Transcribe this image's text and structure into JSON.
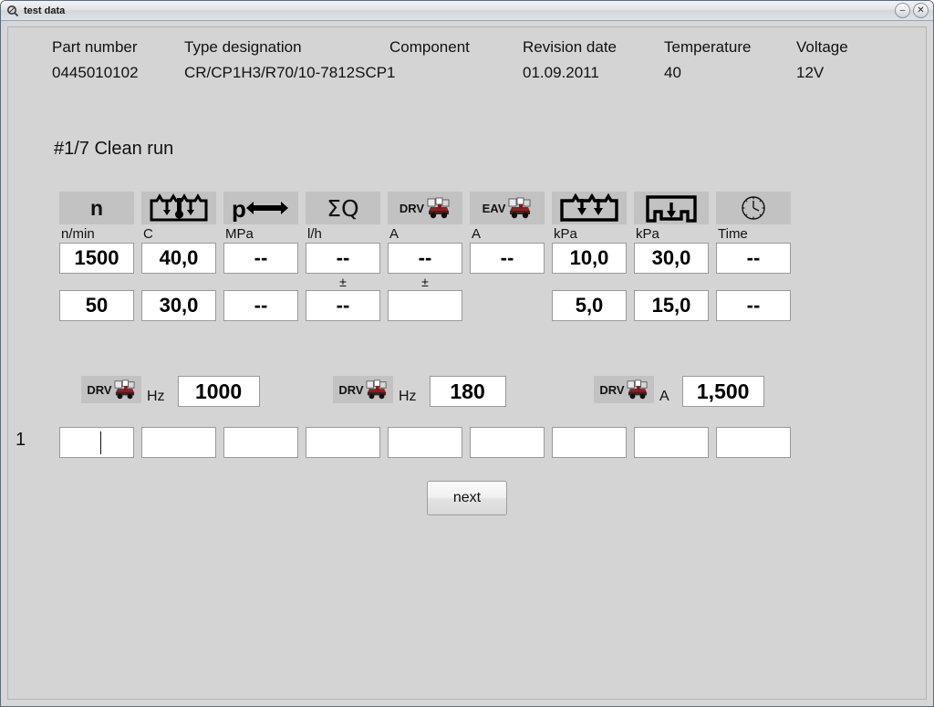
{
  "window": {
    "title": "test data",
    "icon": "app-icon",
    "buttons": [
      {
        "name": "minimize-button",
        "glyph": "–"
      },
      {
        "name": "close-button",
        "glyph": "✕"
      }
    ]
  },
  "meta": [
    {
      "label": "Part number",
      "value": "0445010102"
    },
    {
      "label": "Type designation",
      "value": "CR/CP1H3/R70/10-7812SCP1"
    },
    {
      "label": "Component",
      "value": ""
    },
    {
      "label": "Revision date",
      "value": "01.09.2011"
    },
    {
      "label": "Temperature",
      "value": "40"
    },
    {
      "label": "Voltage",
      "value": "12V"
    }
  ],
  "run_title": "#1/7 Clean run",
  "columns": [
    {
      "icon": "speed-n-icon",
      "icon_text": "n",
      "unit": "n/min"
    },
    {
      "icon": "temperature-icon",
      "icon_text": "",
      "unit": "C"
    },
    {
      "icon": "rail-pressure-icon",
      "icon_text": "p",
      "unit": "MPa"
    },
    {
      "icon": "sum-flow-icon",
      "icon_text": "ΣQ",
      "unit": "l/h"
    },
    {
      "icon": "drv-current-icon",
      "icon_text": "DRV",
      "unit": "A"
    },
    {
      "icon": "eav-current-icon",
      "icon_text": "EAV",
      "unit": "A"
    },
    {
      "icon": "inlet-pressure-icon",
      "icon_text": "",
      "unit": "kPa"
    },
    {
      "icon": "return-pressure-icon",
      "icon_text": "",
      "unit": "kPa"
    },
    {
      "icon": "time-clock-icon",
      "icon_text": "",
      "unit": "Time"
    }
  ],
  "rows": {
    "row1": [
      "1500",
      "40,0",
      "--",
      "--",
      "--",
      "--",
      "10,0",
      "30,0",
      "--"
    ],
    "row1_tolerance": [
      "",
      "",
      "",
      "±",
      "±",
      "",
      "",
      "",
      ""
    ],
    "row2": [
      "50",
      "30,0",
      "--",
      "--",
      "",
      null,
      "5,0",
      "15,0",
      "--"
    ]
  },
  "params": [
    {
      "icon": "drv-frequency-icon",
      "icon_text": "DRV",
      "unit": "Hz",
      "value": "1000"
    },
    {
      "icon": "drv-frequency-icon",
      "icon_text": "DRV",
      "unit": "Hz",
      "value": "180"
    },
    {
      "icon": "drv-current-icon",
      "icon_text": "DRV",
      "unit": "A",
      "value": "1,500"
    }
  ],
  "entry_row": {
    "label": "1",
    "values": [
      "",
      "",
      "",
      "",
      "",
      "",
      "",
      "",
      ""
    ],
    "focused_index": 0
  },
  "next_button": "next",
  "colors": {
    "window_background": "#d4d4d4",
    "icon_background": "#c2c2c2",
    "field_background": "#ffffff",
    "field_border": "#9a9a9a",
    "text": "#111111"
  }
}
